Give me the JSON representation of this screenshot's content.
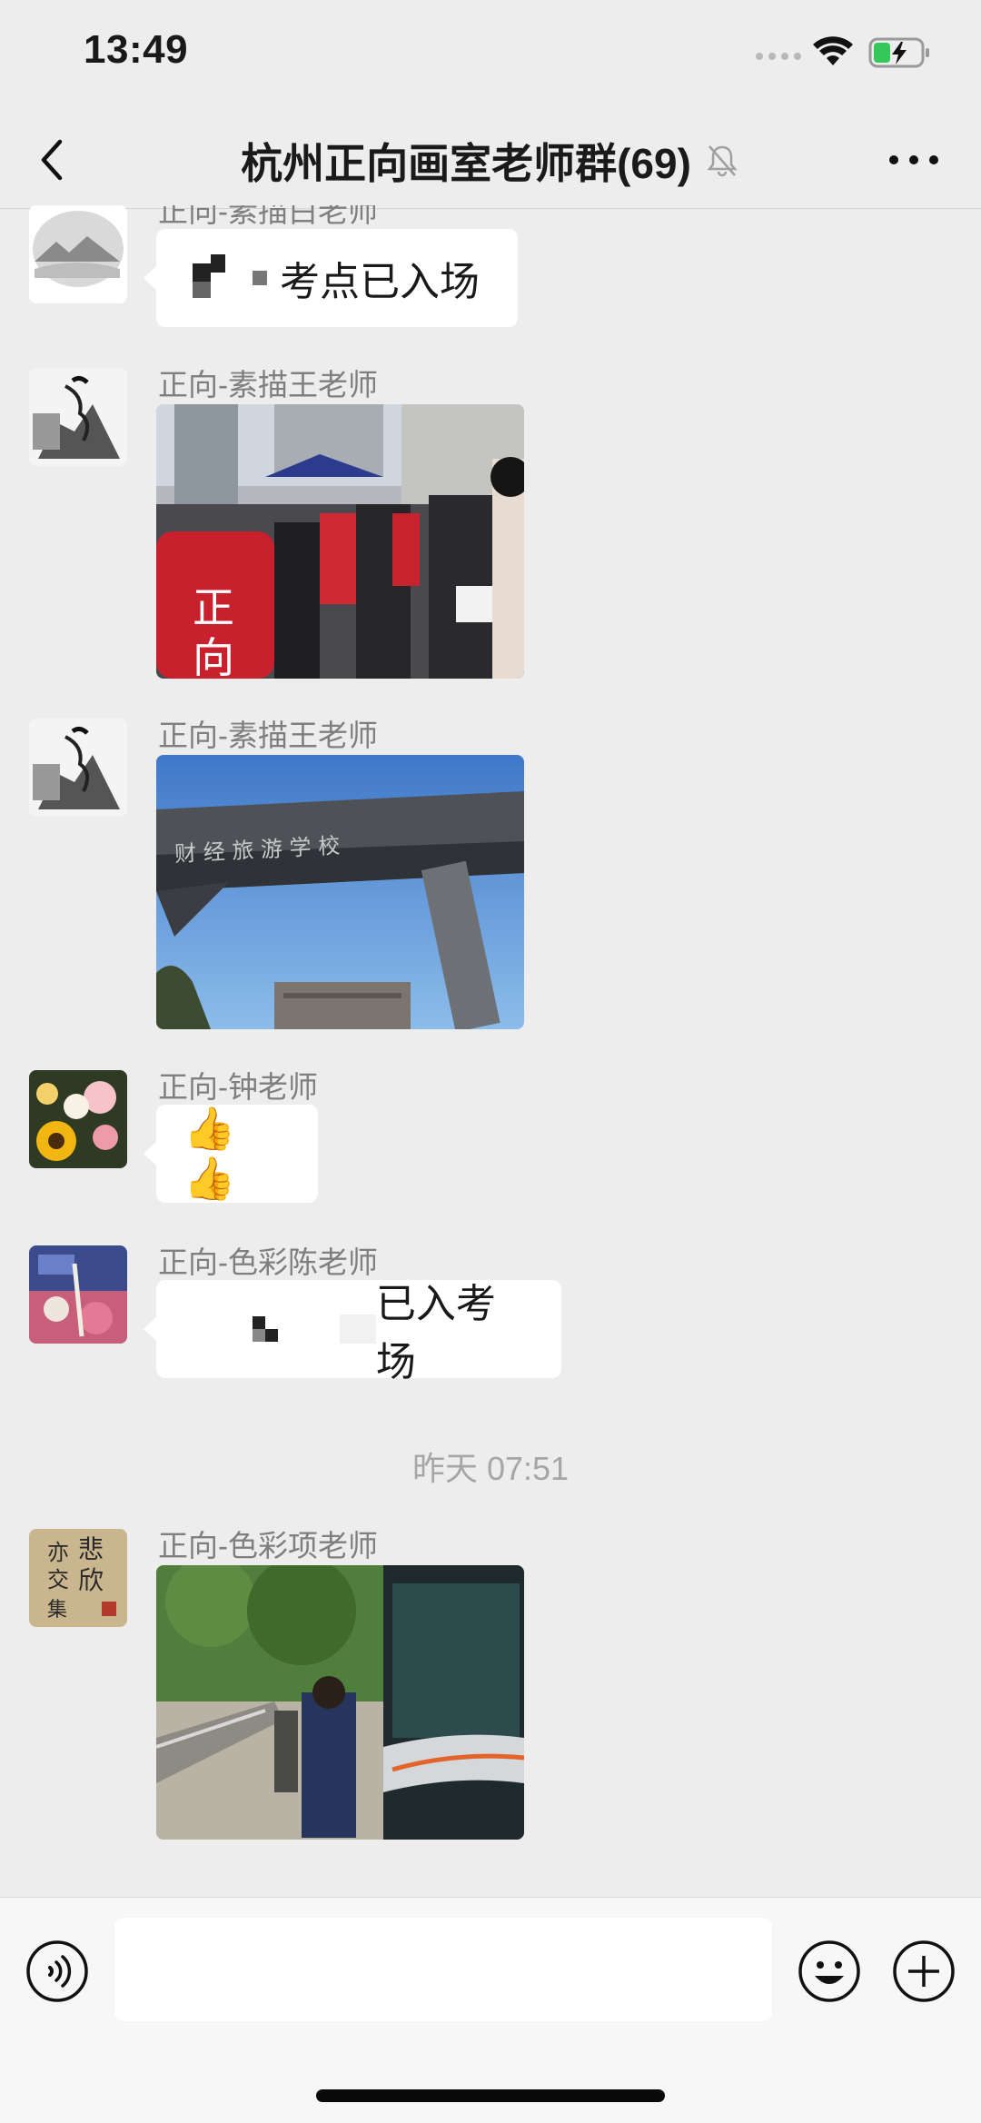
{
  "status_bar": {
    "time": "13:49"
  },
  "nav": {
    "title": "杭州正向画室老师群(69)"
  },
  "messages": [
    {
      "sender": "正向-素描白老师",
      "text": "考点已入场",
      "type": "text"
    },
    {
      "sender": "正向-素描王老师",
      "type": "image",
      "image_icon": "students-queue-photo"
    },
    {
      "sender": "正向-素描王老师",
      "type": "image",
      "image_icon": "school-gate-photo"
    },
    {
      "sender": "正向-钟老师",
      "text": "👍👍",
      "type": "text"
    },
    {
      "sender": "正向-色彩陈老师",
      "text": "已入考场",
      "type": "text"
    },
    {
      "sender": "正向-色彩项老师",
      "type": "image",
      "image_icon": "bus-station-photo"
    }
  ],
  "timestamp": "昨天 07:51",
  "input": {
    "placeholder": ""
  },
  "colors": {
    "background": "#ededed",
    "bubble": "#ffffff",
    "battery_green": "#34c759"
  }
}
